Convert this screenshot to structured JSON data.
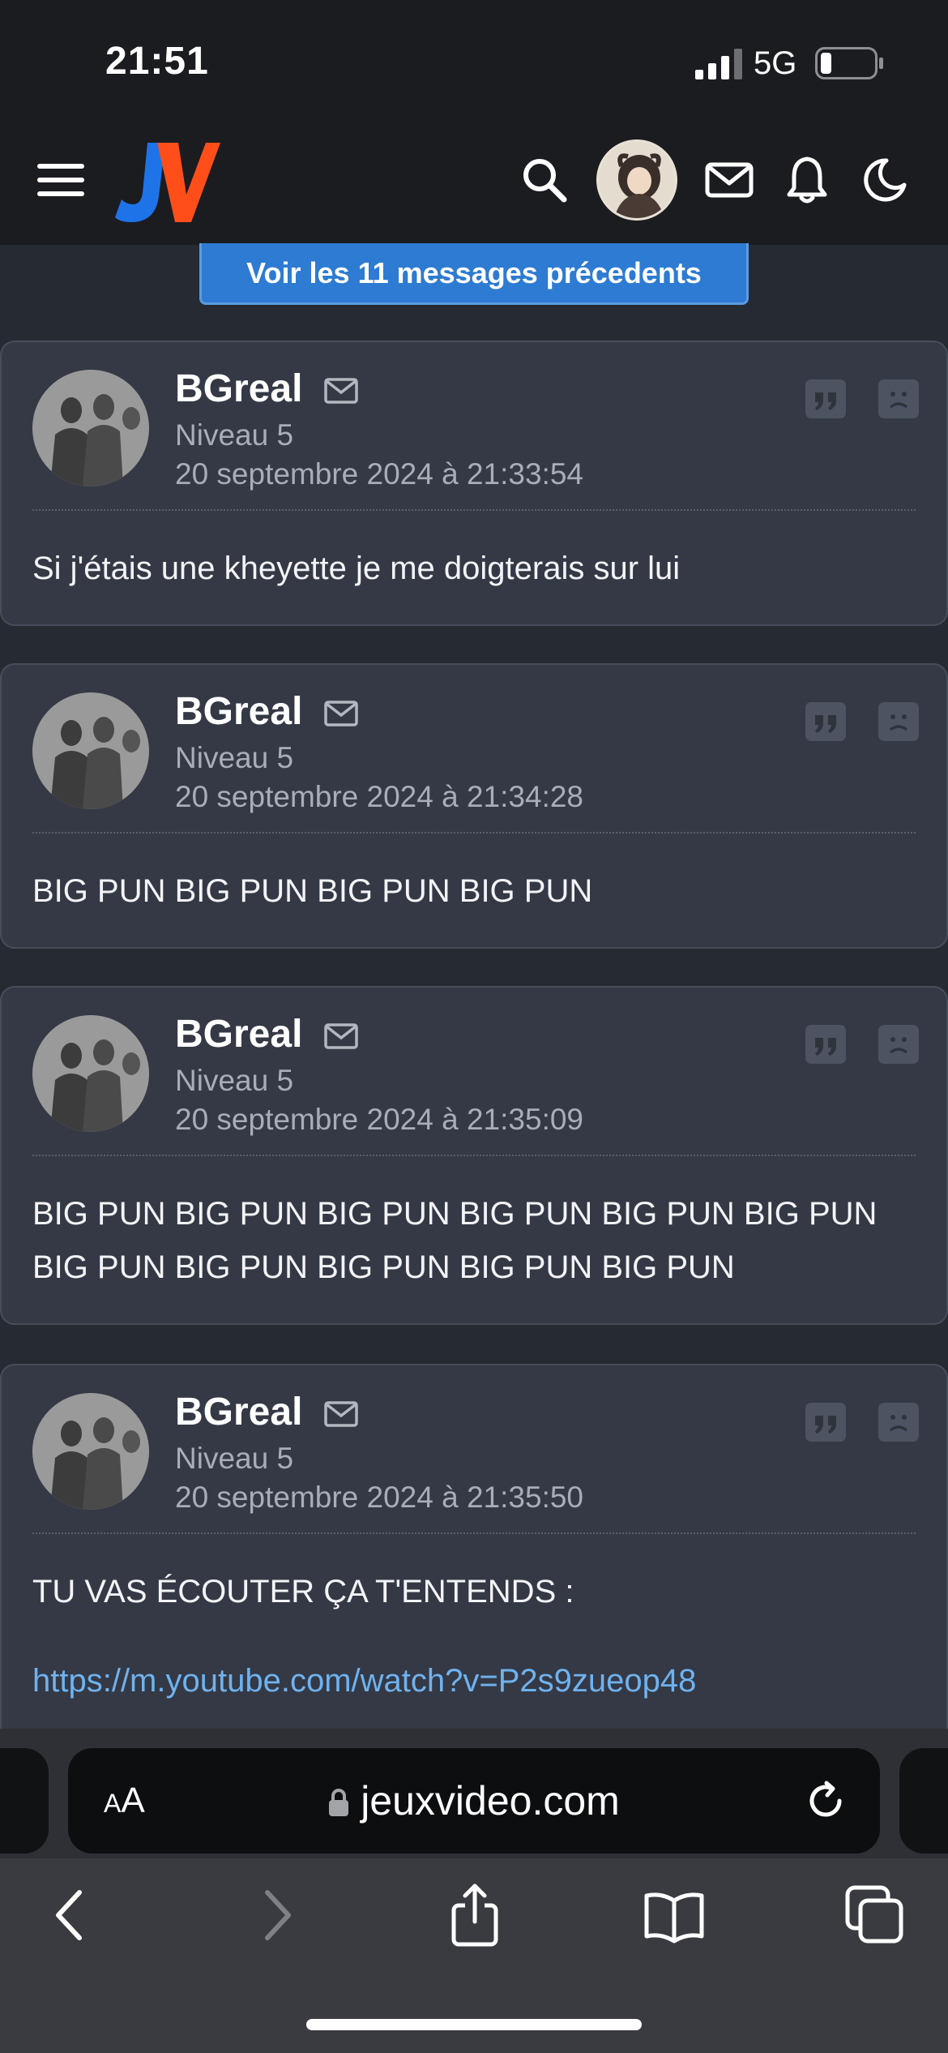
{
  "status_bar": {
    "time": "21:51",
    "network": "5G"
  },
  "header": {
    "logo_text": "JV",
    "icons": [
      "menu-icon",
      "search-icon",
      "avatar",
      "mail-icon",
      "bell-icon",
      "dark-mode-icon"
    ]
  },
  "feed": {
    "prev_button_label": "Voir les 11 messages précedents",
    "posts": [
      {
        "author": "BGreal",
        "level": "Niveau 5",
        "date": "20 septembre 2024 à 21:33:54",
        "body": "Si j'étais une kheyette je me doigterais sur lui"
      },
      {
        "author": "BGreal",
        "level": "Niveau 5",
        "date": "20 septembre 2024 à 21:34:28",
        "body": "BIG PUN BIG PUN BIG PUN BIG PUN"
      },
      {
        "author": "BGreal",
        "level": "Niveau 5",
        "date": "20 septembre 2024 à 21:35:09",
        "body_line1": "BIG PUN BIG PUN BIG PUN BIG PUN BIG PUN BIG PUN",
        "body_line2": "BIG PUN BIG PUN BIG PUN BIG PUN BIG PUN"
      },
      {
        "author": "BGreal",
        "level": "Niveau 5",
        "date": "20 septembre 2024 à 21:35:50",
        "body": "TU VAS ÉCOUTER ÇA T'ENTENDS :",
        "link": "https://m.youtube.com/watch?v=P2s9zueop48"
      }
    ]
  },
  "safari": {
    "aa_label_small": "A",
    "aa_label_large": "A",
    "url": "jeuxvideo.com"
  },
  "colors": {
    "page_bg": "#262a32",
    "post_bg": "#343945",
    "accent_blue": "#2d7bd2",
    "link": "#6fb2ef",
    "logo_blue": "#1e73e8",
    "logo_orange": "#ff4e1a"
  }
}
